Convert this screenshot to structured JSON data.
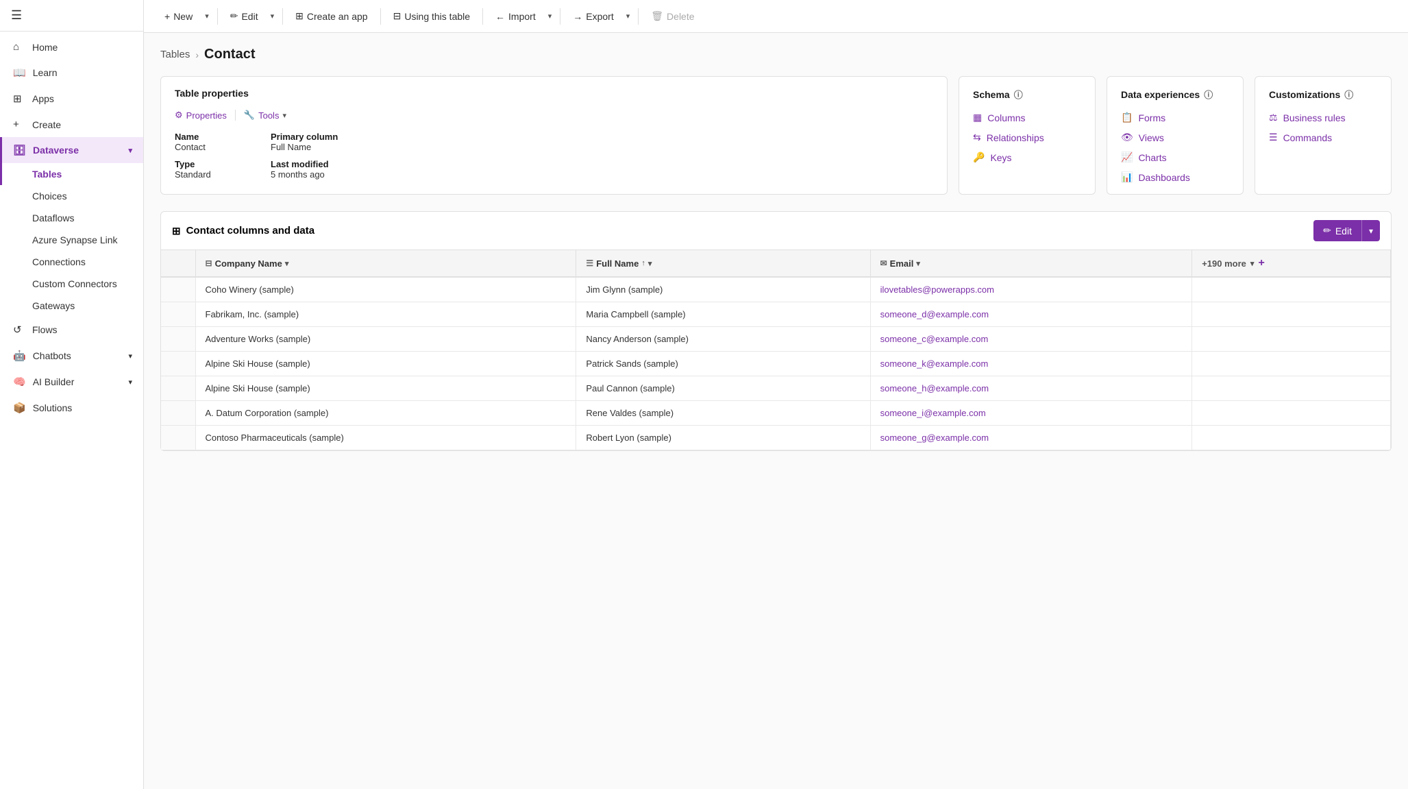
{
  "sidebar": {
    "hamburger": "☰",
    "items": [
      {
        "id": "home",
        "label": "Home",
        "icon": "home",
        "active": false
      },
      {
        "id": "learn",
        "label": "Learn",
        "icon": "book",
        "active": false
      },
      {
        "id": "apps",
        "label": "Apps",
        "icon": "apps",
        "active": false
      },
      {
        "id": "create",
        "label": "Create",
        "icon": "plus",
        "active": false
      },
      {
        "id": "dataverse",
        "label": "Dataverse",
        "icon": "db",
        "active": true,
        "expanded": true
      }
    ],
    "dataverse_sub": [
      {
        "id": "tables",
        "label": "Tables",
        "active": true
      },
      {
        "id": "choices",
        "label": "Choices",
        "active": false
      },
      {
        "id": "dataflows",
        "label": "Dataflows",
        "active": false
      },
      {
        "id": "azure-synapse",
        "label": "Azure Synapse Link",
        "active": false
      },
      {
        "id": "connections",
        "label": "Connections",
        "active": false
      },
      {
        "id": "custom-connectors",
        "label": "Custom Connectors",
        "active": false
      },
      {
        "id": "gateways",
        "label": "Gateways",
        "active": false
      }
    ],
    "bottom_items": [
      {
        "id": "flows",
        "label": "Flows",
        "icon": "flow"
      },
      {
        "id": "chatbots",
        "label": "Chatbots",
        "icon": "bot",
        "hasChevron": true
      },
      {
        "id": "ai-builder",
        "label": "AI Builder",
        "icon": "ai",
        "hasChevron": true
      },
      {
        "id": "solutions",
        "label": "Solutions",
        "icon": "sol"
      }
    ]
  },
  "toolbar": {
    "new_label": "New",
    "edit_label": "Edit",
    "create_app_label": "Create an app",
    "using_table_label": "Using this table",
    "import_label": "Import",
    "export_label": "Export",
    "delete_label": "Delete"
  },
  "breadcrumb": {
    "tables": "Tables",
    "sep": "›",
    "contact": "Contact"
  },
  "table_props_card": {
    "header": "Table properties",
    "properties_btn": "Properties",
    "tools_btn": "Tools",
    "name_label": "Name",
    "name_value": "Contact",
    "type_label": "Type",
    "type_value": "Standard",
    "primary_column_label": "Primary column",
    "primary_column_value": "Full Name",
    "last_modified_label": "Last modified",
    "last_modified_value": "5 months ago"
  },
  "schema_card": {
    "header": "Schema",
    "info": "ⓘ",
    "items": [
      {
        "id": "columns",
        "label": "Columns",
        "icon": "columns"
      },
      {
        "id": "relationships",
        "label": "Relationships",
        "icon": "relations"
      },
      {
        "id": "keys",
        "label": "Keys",
        "icon": "keys"
      }
    ]
  },
  "data_experiences_card": {
    "header": "Data experiences",
    "info": "ⓘ",
    "items": [
      {
        "id": "forms",
        "label": "Forms",
        "icon": "forms"
      },
      {
        "id": "views",
        "label": "Views",
        "icon": "views"
      },
      {
        "id": "charts",
        "label": "Charts",
        "icon": "charts"
      },
      {
        "id": "dashboards",
        "label": "Dashboards",
        "icon": "dashboards"
      }
    ]
  },
  "customizations_card": {
    "header": "Customizations",
    "info": "ⓘ",
    "items": [
      {
        "id": "business-rules",
        "label": "Business rules",
        "icon": "biz"
      },
      {
        "id": "commands",
        "label": "Commands",
        "icon": "cmds"
      }
    ]
  },
  "data_section": {
    "title": "Contact columns and data",
    "edit_label": "Edit",
    "columns": [
      {
        "id": "company",
        "label": "Company Name",
        "icon": "company"
      },
      {
        "id": "fullname",
        "label": "Full Name",
        "icon": "fullname",
        "sort": "asc"
      },
      {
        "id": "email",
        "label": "Email",
        "icon": "email"
      }
    ],
    "more_cols": "+190 more",
    "rows": [
      {
        "company": "Coho Winery (sample)",
        "fullname": "Jim Glynn (sample)",
        "email": "ilovetables@powerapps.com"
      },
      {
        "company": "Fabrikam, Inc. (sample)",
        "fullname": "Maria Campbell (sample)",
        "email": "someone_d@example.com"
      },
      {
        "company": "Adventure Works (sample)",
        "fullname": "Nancy Anderson (sample)",
        "email": "someone_c@example.com"
      },
      {
        "company": "Alpine Ski House (sample)",
        "fullname": "Patrick Sands (sample)",
        "email": "someone_k@example.com"
      },
      {
        "company": "Alpine Ski House (sample)",
        "fullname": "Paul Cannon (sample)",
        "email": "someone_h@example.com"
      },
      {
        "company": "A. Datum Corporation (sample)",
        "fullname": "Rene Valdes (sample)",
        "email": "someone_i@example.com"
      },
      {
        "company": "Contoso Pharmaceuticals (sample)",
        "fullname": "Robert Lyon (sample)",
        "email": "someone_g@example.com"
      }
    ]
  },
  "colors": {
    "accent": "#7b2fa8",
    "active_border": "#7b2fa8",
    "link": "#7b2fa8"
  }
}
